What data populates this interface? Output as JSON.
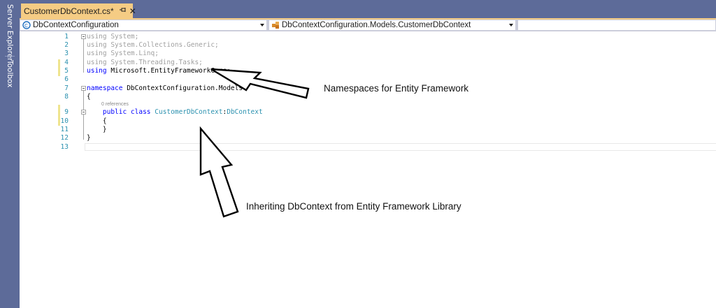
{
  "sidebar": {
    "items": [
      "Server Explorer",
      "Toolbox"
    ]
  },
  "tab": {
    "title": "CustomerDbContext.cs*",
    "pin_icon": "pin-icon",
    "close_icon": "close-icon"
  },
  "navbar": {
    "project": "DbContextConfiguration",
    "class": "DbContextConfiguration.Models.CustomerDbContext",
    "member": ""
  },
  "editor": {
    "line_numbers": [
      "1",
      "2",
      "3",
      "4",
      "5",
      "6",
      "7",
      "8",
      "9",
      "10",
      "11",
      "12",
      "13"
    ],
    "code": {
      "l1_kw": "using",
      "l1_ns": " System;",
      "l2_kw": "using",
      "l2_ns": " System.Collections.Generic;",
      "l3_kw": "using",
      "l3_ns": " System.Linq;",
      "l4_kw": "using",
      "l4_ns": " System.Threading.Tasks;",
      "l5_kw": "using",
      "l5_ns": " Microsoft.EntityFrameworkCore;",
      "l7_kw": "namespace",
      "l7_name": " DbContextConfiguration.Models",
      "l8": "{",
      "l9_indent": "    ",
      "l9_kw": "public class",
      "l9_sp": " ",
      "l9_class": "CustomerDbContext",
      "l9_colon": ":",
      "l9_base": "DbContext",
      "l10": "    {",
      "l11": "    }",
      "l12": "}"
    },
    "references": "0 references"
  },
  "annotations": {
    "namespaces": "Namespaces for Entity Framework",
    "inheriting": "Inheriting  DbContext from Entity Framework Library"
  },
  "colors": {
    "keyword": "#0000ff",
    "type": "#2b91af",
    "tab": "#f5cc84",
    "chrome": "#5d6b99",
    "change_marker": "#efe48e"
  }
}
